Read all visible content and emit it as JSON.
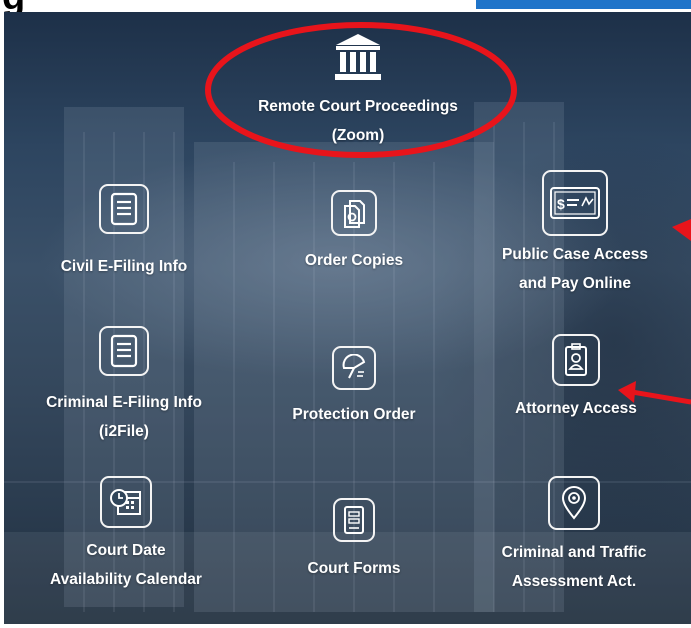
{
  "header": {
    "heading_fragment": "g"
  },
  "tiles": {
    "remote": {
      "label_line1": "Remote Court Proceedings",
      "label_line2": "(Zoom)",
      "icon": "courthouse-icon"
    },
    "civil": {
      "label": "Civil E-Filing Info",
      "icon": "document-icon"
    },
    "order_copies": {
      "label": "Order Copies",
      "icon": "copies-icon"
    },
    "public_case": {
      "label_line1": "Public Case Access",
      "label_line2": "and Pay Online",
      "icon": "payment-card-icon"
    },
    "criminal_efiling": {
      "label_line1": "Criminal E-Filing Info",
      "label_line2": "(i2File)",
      "icon": "document-icon"
    },
    "protection_order": {
      "label": "Protection Order",
      "icon": "umbrella-icon"
    },
    "attorney": {
      "label": "Attorney Access",
      "icon": "id-badge-icon"
    },
    "calendar": {
      "label_line1": "Court Date",
      "label_line2": "Availability Calendar",
      "icon": "calendar-clock-icon"
    },
    "court_forms": {
      "label": "Court Forms",
      "icon": "form-icon"
    },
    "criminal_traffic": {
      "label_line1": "Criminal and Traffic",
      "label_line2": "Assessment Act.",
      "icon": "location-pin-icon"
    }
  },
  "annotations": {
    "circle_color": "#e8141b",
    "arrow_color": "#e8141b"
  }
}
